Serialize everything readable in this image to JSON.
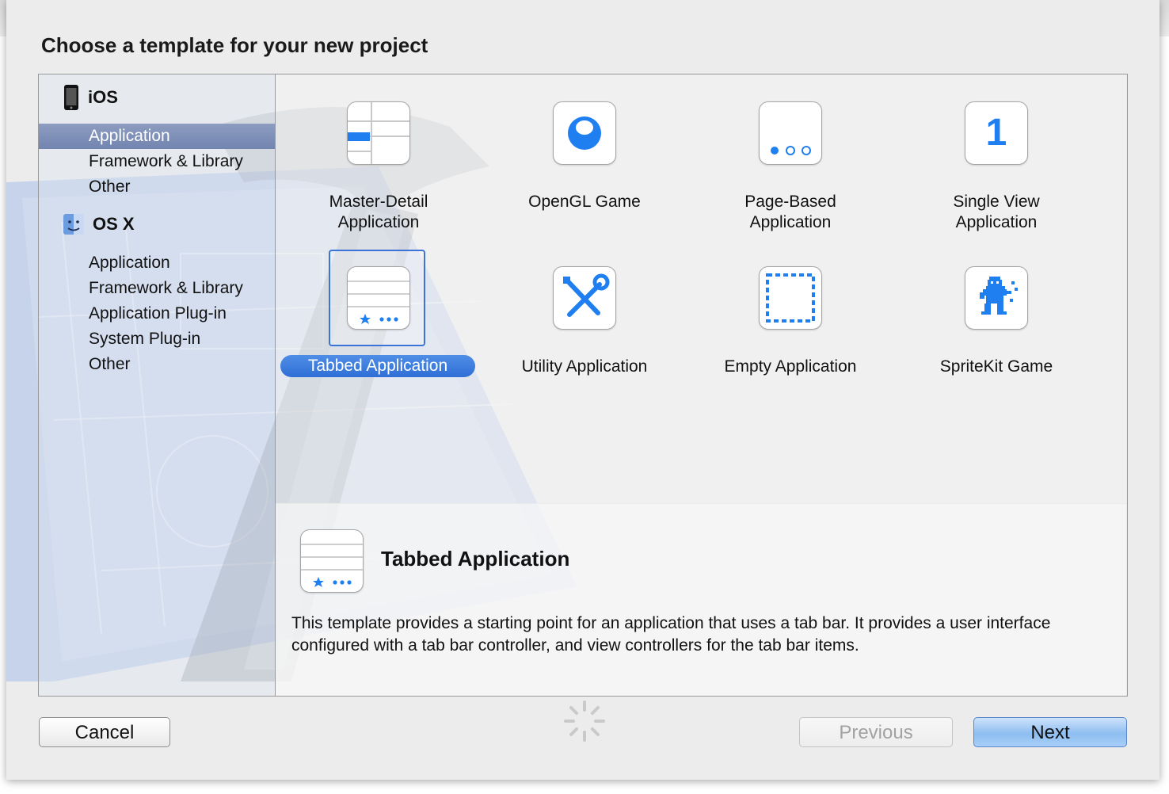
{
  "dialog": {
    "title": "Choose a template for your new project"
  },
  "sidebar": {
    "sections": [
      {
        "heading": "iOS",
        "icon": "iphone-icon",
        "items": [
          "Application",
          "Framework & Library",
          "Other"
        ]
      },
      {
        "heading": "OS X",
        "icon": "finder-icon",
        "items": [
          "Application",
          "Framework & Library",
          "Application Plug-in",
          "System Plug-in",
          "Other"
        ]
      }
    ],
    "selected": "iOS > Application"
  },
  "templates": [
    {
      "label_line1": "Master-Detail",
      "label_line2": "Application",
      "icon": "master-detail-icon"
    },
    {
      "label_line1": "OpenGL Game",
      "label_line2": "",
      "icon": "opengl-icon"
    },
    {
      "label_line1": "Page-Based",
      "label_line2": "Application",
      "icon": "page-based-icon"
    },
    {
      "label_line1": "Single View",
      "label_line2": "Application",
      "icon": "single-view-icon"
    },
    {
      "label_line1": "Tabbed Application",
      "label_line2": "",
      "icon": "tabbed-icon",
      "selected": true
    },
    {
      "label_line1": "Utility Application",
      "label_line2": "",
      "icon": "utility-icon"
    },
    {
      "label_line1": "Empty Application",
      "label_line2": "",
      "icon": "empty-icon"
    },
    {
      "label_line1": "SpriteKit Game",
      "label_line2": "",
      "icon": "spritekit-icon"
    }
  ],
  "single_view_number": "1",
  "detail": {
    "title": "Tabbed Application",
    "description": "This template provides a starting point for an application that uses a tab bar. It provides a user interface configured with a tab bar controller, and view controllers for the tab bar items."
  },
  "buttons": {
    "cancel": "Cancel",
    "previous": "Previous",
    "next": "Next"
  },
  "colors": {
    "accent": "#2f6fd6",
    "icon_blue": "#1f7ff0",
    "sidebar_selection": "#7f90b8"
  }
}
